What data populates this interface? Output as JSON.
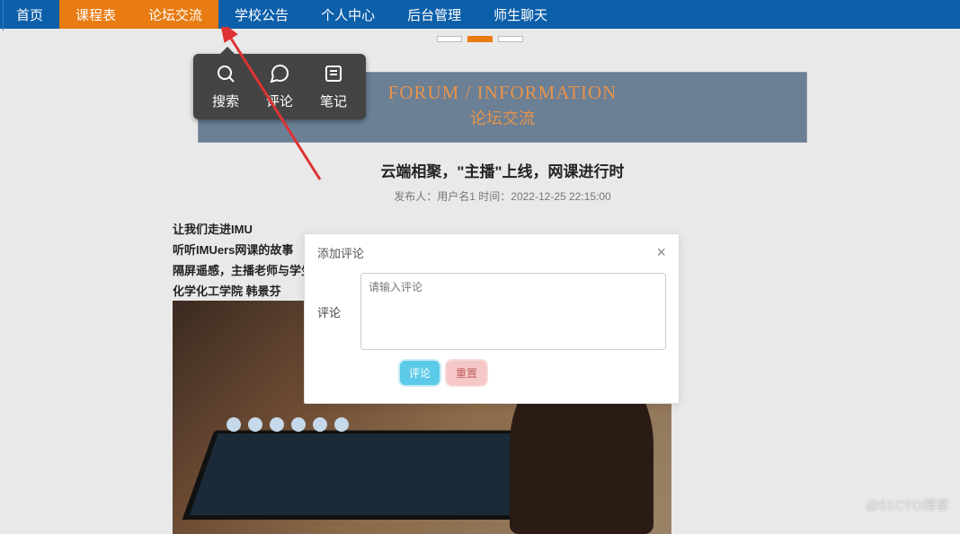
{
  "nav": {
    "items": [
      {
        "label": "首页",
        "active": false
      },
      {
        "label": "课程表",
        "active": true
      },
      {
        "label": "论坛交流",
        "active": true
      },
      {
        "label": "学校公告",
        "active": false
      },
      {
        "label": "个人中心",
        "active": false
      },
      {
        "label": "后台管理",
        "active": false
      },
      {
        "label": "师生聊天",
        "active": false
      }
    ]
  },
  "toolpop": {
    "items": [
      {
        "icon": "search-icon",
        "label": "搜索"
      },
      {
        "icon": "comment-icon",
        "label": "评论"
      },
      {
        "icon": "note-icon",
        "label": "笔记"
      }
    ]
  },
  "banner": {
    "eng": "FORUM / INFORMATION",
    "chn": "论坛交流"
  },
  "article": {
    "title": "云端相聚，\"主播\"上线，网课进行时",
    "meta": "发布人：用户名1 时间：2022-12-25 22:15:00",
    "paragraphs": [
      "让我们走进IMU",
      "听听IMUers网课的故事",
      "隔屏遥感，主播老师与学生",
      "化学化工学院  韩景芬"
    ]
  },
  "modal": {
    "title": "添加评论",
    "field_label": "评论",
    "placeholder": "请输入评论",
    "submit": "评论",
    "reset": "重置"
  },
  "watermark": "@51CTO博客"
}
